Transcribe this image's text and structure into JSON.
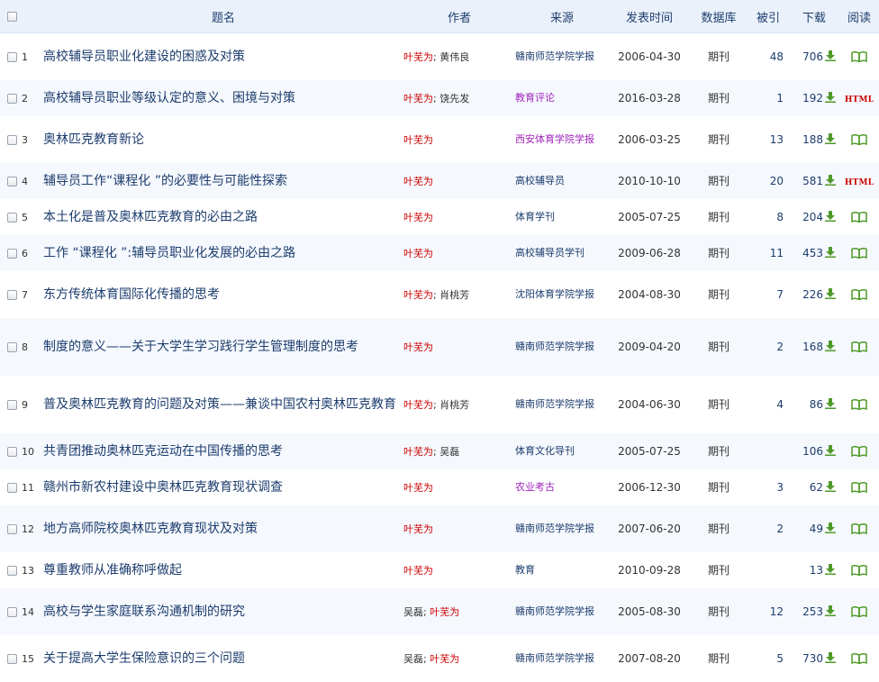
{
  "header": {
    "title": "题名",
    "author": "作者",
    "source": "来源",
    "date": "发表时间",
    "database": "数据库",
    "cited": "被引",
    "downloads": "下载",
    "read": "阅读"
  },
  "colors": {
    "highlight_author": "#cc0000",
    "link": "#1c3c6d",
    "source_purple": "#a026bb",
    "download_green": "#4f9a2a",
    "header_bg": "#eaf1fb"
  },
  "rows": [
    {
      "num": "1",
      "title": "高校辅导员职业化建设的困惑及对策",
      "authors": [
        {
          "name": "叶芜为",
          "hl": true
        },
        {
          "name": "黄伟良",
          "hl": false
        }
      ],
      "source": "赣南师范学院学报",
      "source_color": "normal",
      "date": "2006-04-30",
      "db": "期刊",
      "cited": "48",
      "downloads": "706",
      "read": "book-icon"
    },
    {
      "num": "2",
      "title": "高校辅导员职业等级认定的意义、困境与对策",
      "authors": [
        {
          "name": "叶芜为",
          "hl": true
        },
        {
          "name": "饶先发",
          "hl": false
        }
      ],
      "source": "教育评论",
      "source_color": "purple",
      "date": "2016-03-28",
      "db": "期刊",
      "cited": "1",
      "downloads": "192",
      "read": "HTML"
    },
    {
      "num": "3",
      "title": "奥林匹克教育新论",
      "authors": [
        {
          "name": "叶芜为",
          "hl": true
        }
      ],
      "source": "西安体育学院学报",
      "source_color": "purple",
      "date": "2006-03-25",
      "db": "期刊",
      "cited": "13",
      "downloads": "188",
      "read": "book-icon"
    },
    {
      "num": "4",
      "title": "辅导员工作“课程化 ”的必要性与可能性探索",
      "authors": [
        {
          "name": "叶芜为",
          "hl": true
        }
      ],
      "source": "高校辅导员",
      "source_color": "normal",
      "date": "2010-10-10",
      "db": "期刊",
      "cited": "20",
      "downloads": "581",
      "read": "HTML"
    },
    {
      "num": "5",
      "title": "本土化是普及奥林匹克教育的必由之路",
      "authors": [
        {
          "name": "叶芜为",
          "hl": true
        }
      ],
      "source": "体育学刊",
      "source_color": "normal",
      "date": "2005-07-25",
      "db": "期刊",
      "cited": "8",
      "downloads": "204",
      "read": "book-icon"
    },
    {
      "num": "6",
      "title": "工作 “课程化 ”:辅导员职业化发展的必由之路",
      "authors": [
        {
          "name": "叶芜为",
          "hl": true
        }
      ],
      "source": "高校辅导员学刊",
      "source_color": "normal",
      "date": "2009-06-28",
      "db": "期刊",
      "cited": "11",
      "downloads": "453",
      "read": "book-icon"
    },
    {
      "num": "7",
      "title": "东方传统体育国际化传播的思考",
      "authors": [
        {
          "name": "叶芜为",
          "hl": true
        },
        {
          "name": "肖桃芳",
          "hl": false
        }
      ],
      "source": "沈阳体育学院学报",
      "source_color": "normal",
      "date": "2004-08-30",
      "db": "期刊",
      "cited": "7",
      "downloads": "226",
      "read": "book-icon"
    },
    {
      "num": "8",
      "title": "制度的意义——关于大学生学习践行学生管理制度的思考",
      "authors": [
        {
          "name": "叶芜为",
          "hl": true
        }
      ],
      "source": "赣南师范学院学报",
      "source_color": "normal",
      "date": "2009-04-20",
      "db": "期刊",
      "cited": "2",
      "downloads": "168",
      "read": "book-icon"
    },
    {
      "num": "9",
      "title": "普及奥林匹克教育的问题及对策——兼谈中国农村奥林匹克教育",
      "authors": [
        {
          "name": "叶芜为",
          "hl": true
        },
        {
          "name": "肖桃芳",
          "hl": false
        }
      ],
      "source": "赣南师范学院学报",
      "source_color": "normal",
      "date": "2004-06-30",
      "db": "期刊",
      "cited": "4",
      "downloads": "86",
      "read": "book-icon"
    },
    {
      "num": "10",
      "title": "共青团推动奥林匹克运动在中国传播的思考",
      "authors": [
        {
          "name": "叶芜为",
          "hl": true
        },
        {
          "name": "吴磊",
          "hl": false
        }
      ],
      "source": "体育文化导刊",
      "source_color": "normal",
      "date": "2005-07-25",
      "db": "期刊",
      "cited": "",
      "downloads": "106",
      "read": "book-icon"
    },
    {
      "num": "11",
      "title": "赣州市新农村建设中奥林匹克教育现状调查",
      "authors": [
        {
          "name": "叶芜为",
          "hl": true
        }
      ],
      "source": "农业考古",
      "source_color": "purple",
      "date": "2006-12-30",
      "db": "期刊",
      "cited": "3",
      "downloads": "62",
      "read": "book-icon"
    },
    {
      "num": "12",
      "title": "地方高师院校奥林匹克教育现状及对策",
      "authors": [
        {
          "name": "叶芜为",
          "hl": true
        }
      ],
      "source": "赣南师范学院学报",
      "source_color": "normal",
      "date": "2007-06-20",
      "db": "期刊",
      "cited": "2",
      "downloads": "49",
      "read": "book-icon"
    },
    {
      "num": "13",
      "title": "尊重教师从准确称呼做起",
      "authors": [
        {
          "name": "叶芜为",
          "hl": true
        }
      ],
      "source": "教育",
      "source_color": "normal",
      "date": "2010-09-28",
      "db": "期刊",
      "cited": "",
      "downloads": "13",
      "read": "book-icon"
    },
    {
      "num": "14",
      "title": "高校与学生家庭联系沟通机制的研究",
      "authors": [
        {
          "name": "吴磊",
          "hl": false
        },
        {
          "name": "叶芜为",
          "hl": true
        }
      ],
      "source": "赣南师范学院学报",
      "source_color": "normal",
      "date": "2005-08-30",
      "db": "期刊",
      "cited": "12",
      "downloads": "253",
      "read": "book-icon"
    },
    {
      "num": "15",
      "title": "关于提高大学生保险意识的三个问题",
      "authors": [
        {
          "name": "吴磊",
          "hl": false
        },
        {
          "name": "叶芜为",
          "hl": true
        }
      ],
      "source": "赣南师范学院学报",
      "source_color": "normal",
      "date": "2007-08-20",
      "db": "期刊",
      "cited": "5",
      "downloads": "730",
      "read": "book-icon"
    }
  ]
}
